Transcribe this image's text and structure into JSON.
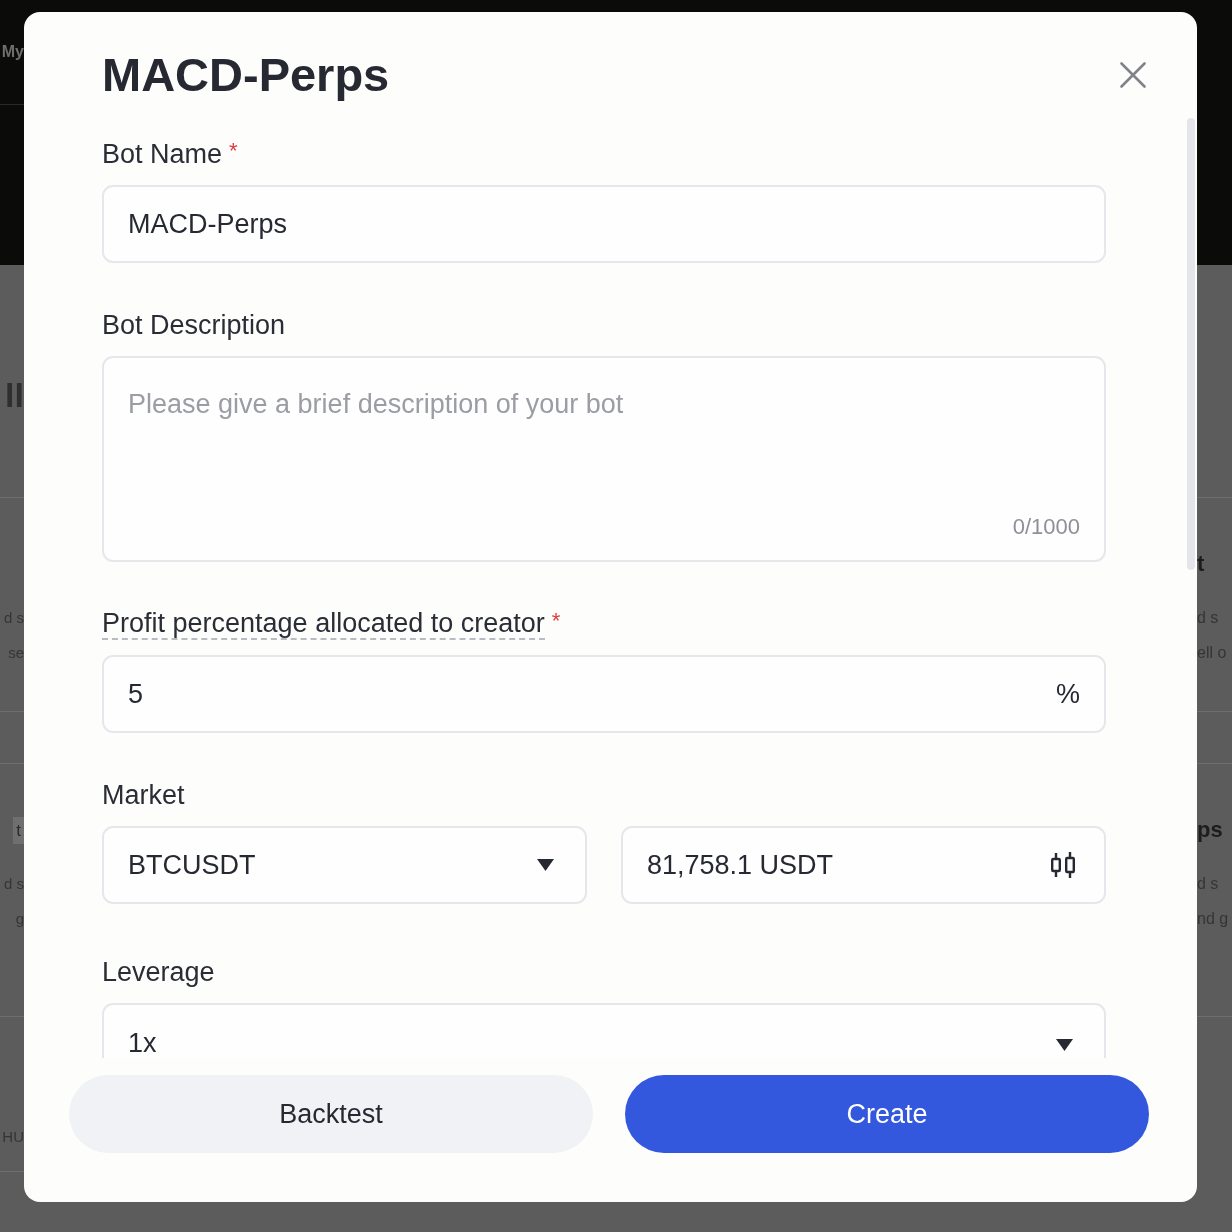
{
  "backdrop": {
    "left": {
      "header": "My",
      "heading": "ll",
      "cards": [
        {
          "lines": [
            "d s",
            "se"
          ]
        },
        {
          "tag": "t",
          "lines": [
            "d s",
            "g"
          ]
        },
        {
          "lines": [
            "HU"
          ]
        }
      ]
    },
    "right": {
      "cards": [
        {
          "title": "t",
          "lines": [
            "d s",
            "ell o"
          ]
        },
        {
          "title": "ps",
          "lines": [
            "d s",
            "nd g"
          ]
        }
      ]
    }
  },
  "dialog": {
    "title": "MACD-Perps",
    "fields": [
      {
        "kind": "text",
        "label": "Bot Name",
        "required_mark": "*",
        "value": "MACD-Perps"
      },
      {
        "kind": "textarea",
        "label": "Bot Description",
        "placeholder": "Please give a brief description of your bot",
        "counter": "0/1000"
      },
      {
        "kind": "number",
        "label": "Profit percentage allocated to creator",
        "tooltip": true,
        "required_mark": "*",
        "value": "5",
        "suffix": "%"
      },
      {
        "kind": "pair",
        "label": "Market",
        "select": {
          "value": "BTCUSDT"
        },
        "price": {
          "value": "81,758.1 USDT"
        }
      },
      {
        "kind": "select",
        "label": "Leverage",
        "value": "1x"
      }
    ],
    "buttons": [
      {
        "label": "Backtest",
        "kind": "secondary"
      },
      {
        "label": "Create",
        "kind": "primary"
      }
    ]
  }
}
